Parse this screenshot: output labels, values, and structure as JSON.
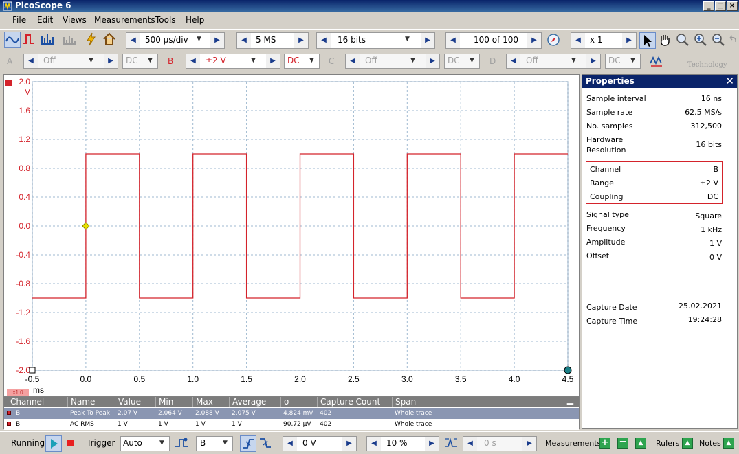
{
  "window": {
    "title": "PicoScope 6"
  },
  "menu": [
    "File",
    "Edit",
    "Views",
    "Measurements",
    "Tools",
    "Help"
  ],
  "toolbar": {
    "timebase": "500 µs/div",
    "samples": "5 MS",
    "resolution": "16 bits",
    "buffer": "100 of 100",
    "zoom": "x 1"
  },
  "channels": {
    "a": {
      "letter": "A",
      "range": "Off",
      "coupling": "DC"
    },
    "b": {
      "letter": "B",
      "range": "±2 V",
      "coupling": "DC"
    },
    "c": {
      "letter": "C",
      "range": "Off",
      "coupling": "DC"
    },
    "d": {
      "letter": "D",
      "range": "Off",
      "coupling": "DC"
    },
    "brand": "Technology"
  },
  "colors": {
    "channel_b": "#d4232b",
    "grid": "#9fb9d0",
    "trigger_marker": "#e8e000"
  },
  "chart_data": {
    "type": "line",
    "y_unit": "V",
    "x_unit": "ms",
    "x_zoom_badge": "x1.0",
    "ylim": [
      -2.0,
      2.0
    ],
    "xlim": [
      -0.5,
      4.5
    ],
    "y_ticks": [
      "2.0",
      "1.6",
      "1.2",
      "0.8",
      "0.4",
      "0.0",
      "-0.4",
      "-0.8",
      "-1.2",
      "-1.6",
      "-2.0"
    ],
    "x_ticks": [
      "-0.5",
      "0.0",
      "0.5",
      "1.0",
      "1.5",
      "2.0",
      "2.5",
      "3.0",
      "3.5",
      "4.0",
      "4.5"
    ],
    "grid": true,
    "series": [
      {
        "x": [
          -0.5,
          0.0,
          0.0,
          0.5,
          0.5,
          1.0,
          1.0,
          1.5,
          1.5,
          2.0,
          2.0,
          2.5,
          2.5,
          3.0,
          3.0,
          3.5,
          3.5,
          4.0,
          4.0,
          4.5
        ],
        "y": [
          -1.0,
          -1.0,
          1.0,
          1.0,
          -1.0,
          -1.0,
          1.0,
          1.0,
          -1.0,
          -1.0,
          1.0,
          1.0,
          -1.0,
          -1.0,
          1.0,
          1.0,
          -1.0,
          -1.0,
          1.0,
          1.0
        ]
      }
    ],
    "trigger_point": [
      0.0,
      0.0
    ]
  },
  "measurements": {
    "headers": [
      "Channel",
      "Name",
      "Value",
      "Min",
      "Max",
      "Average",
      "σ",
      "Capture Count",
      "Span"
    ],
    "rows": [
      [
        "B",
        "Peak To Peak",
        "2.07 V",
        "2.064 V",
        "2.088 V",
        "2.075 V",
        "4.824 mV",
        "402",
        "Whole trace"
      ],
      [
        "B",
        "AC RMS",
        "1 V",
        "1 V",
        "1 V",
        "1 V",
        "90.72 µV",
        "402",
        "Whole trace"
      ]
    ]
  },
  "properties": {
    "title": "Properties",
    "items": [
      {
        "label": "Sample interval",
        "value": "16 ns"
      },
      {
        "label": "Sample rate",
        "value": "62.5 MS/s"
      },
      {
        "label": "No. samples",
        "value": "312,500"
      },
      {
        "label": "Hardware",
        "label2": "Resolution",
        "value": "16 bits"
      }
    ],
    "channel_box": [
      {
        "label": "Channel",
        "value": "B"
      },
      {
        "label": "Range",
        "value": "±2 V"
      },
      {
        "label": "Coupling",
        "value": "DC"
      }
    ],
    "signal": [
      {
        "label": "Signal type",
        "value": "Square"
      },
      {
        "label": "Frequency",
        "value": "1 kHz"
      },
      {
        "label": "Amplitude",
        "value": "1 V"
      },
      {
        "label": "Offset",
        "value": "0 V"
      }
    ],
    "capture": [
      {
        "label": "Capture Date",
        "value": "25.02.2021"
      },
      {
        "label": "Capture Time",
        "value": "19:24:28"
      }
    ]
  },
  "statusbar": {
    "running": "Running",
    "trigger_label": "Trigger",
    "trigger_mode": "Auto",
    "trigger_channel": "B",
    "trigger_level": "0 V",
    "pretrigger": "10 %",
    "delay": "0 s",
    "measurements": "Measurements",
    "rulers": "Rulers",
    "notes": "Notes"
  }
}
